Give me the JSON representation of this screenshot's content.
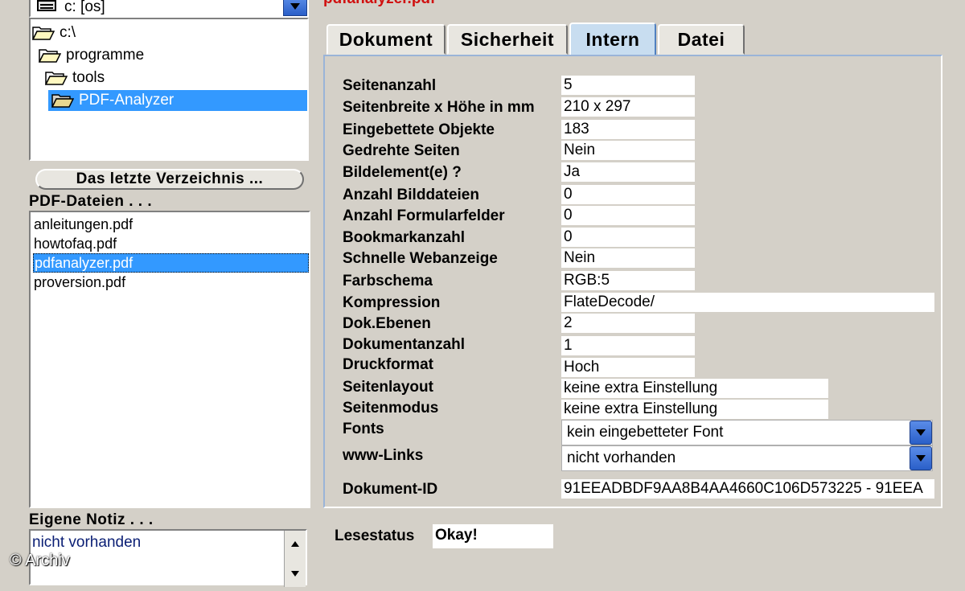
{
  "drive": {
    "label": "c: [os]"
  },
  "tree": {
    "items": [
      {
        "label": "c:\\"
      },
      {
        "label": "programme"
      },
      {
        "label": "tools"
      },
      {
        "label": "PDF-Analyzer"
      }
    ]
  },
  "last_dir_button": "Das letzte Verzeichnis ...",
  "pdf_files": {
    "heading": "PDF-Dateien . . .",
    "items": [
      "anleitungen.pdf",
      "howtofaq.pdf",
      "pdfanalyzer.pdf",
      "proversion.pdf"
    ]
  },
  "note": {
    "heading": "Eigene Notiz . . .",
    "text": "nicht vorhanden"
  },
  "current_file": "pdfanalyzer.pdf",
  "tabs": [
    "Dokument",
    "Sicherheit",
    "Intern",
    "Datei"
  ],
  "fields": [
    {
      "label": "Seitenanzahl",
      "value": "5"
    },
    {
      "label": "Seitenbreite x Höhe in mm",
      "value": "210 x 297"
    },
    {
      "label": "Eingebettete Objekte",
      "value": "183"
    },
    {
      "label": "Gedrehte Seiten",
      "value": "Nein"
    },
    {
      "label": "Bildelement(e) ?",
      "value": "Ja"
    },
    {
      "label": "Anzahl Bilddateien",
      "value": "0"
    },
    {
      "label": "Anzahl Formularfelder",
      "value": "0"
    },
    {
      "label": "Bookmarkanzahl",
      "value": "0"
    },
    {
      "label": "Schnelle Webanzeige",
      "value": "Nein"
    },
    {
      "label": "Farbschema",
      "value": "RGB:5"
    },
    {
      "label": "Kompression",
      "value": "FlateDecode/"
    },
    {
      "label": "Dok.Ebenen",
      "value": "2"
    },
    {
      "label": "Dokumentanzahl",
      "value": "1"
    },
    {
      "label": "Druckformat",
      "value": "Hoch"
    },
    {
      "label": "Seitenlayout",
      "value": "keine extra Einstellung"
    },
    {
      "label": "Seitenmodus",
      "value": "keine extra Einstellung"
    },
    {
      "label": "Fonts",
      "value": "kein eingebetteter Font"
    },
    {
      "label": "www-Links",
      "value": "nicht vorhanden"
    },
    {
      "label": "Dokument-ID",
      "value": "91EEADBDF9AA8B4AA4660C106D573225 - 91EEA"
    }
  ],
  "lesestatus": {
    "label": "Lesestatus",
    "value": "Okay!"
  },
  "watermark": "© Archiv",
  "colors": {
    "selection": "#3399ff",
    "title_red": "#d01010",
    "accent_blue": "#2a5fc8"
  }
}
